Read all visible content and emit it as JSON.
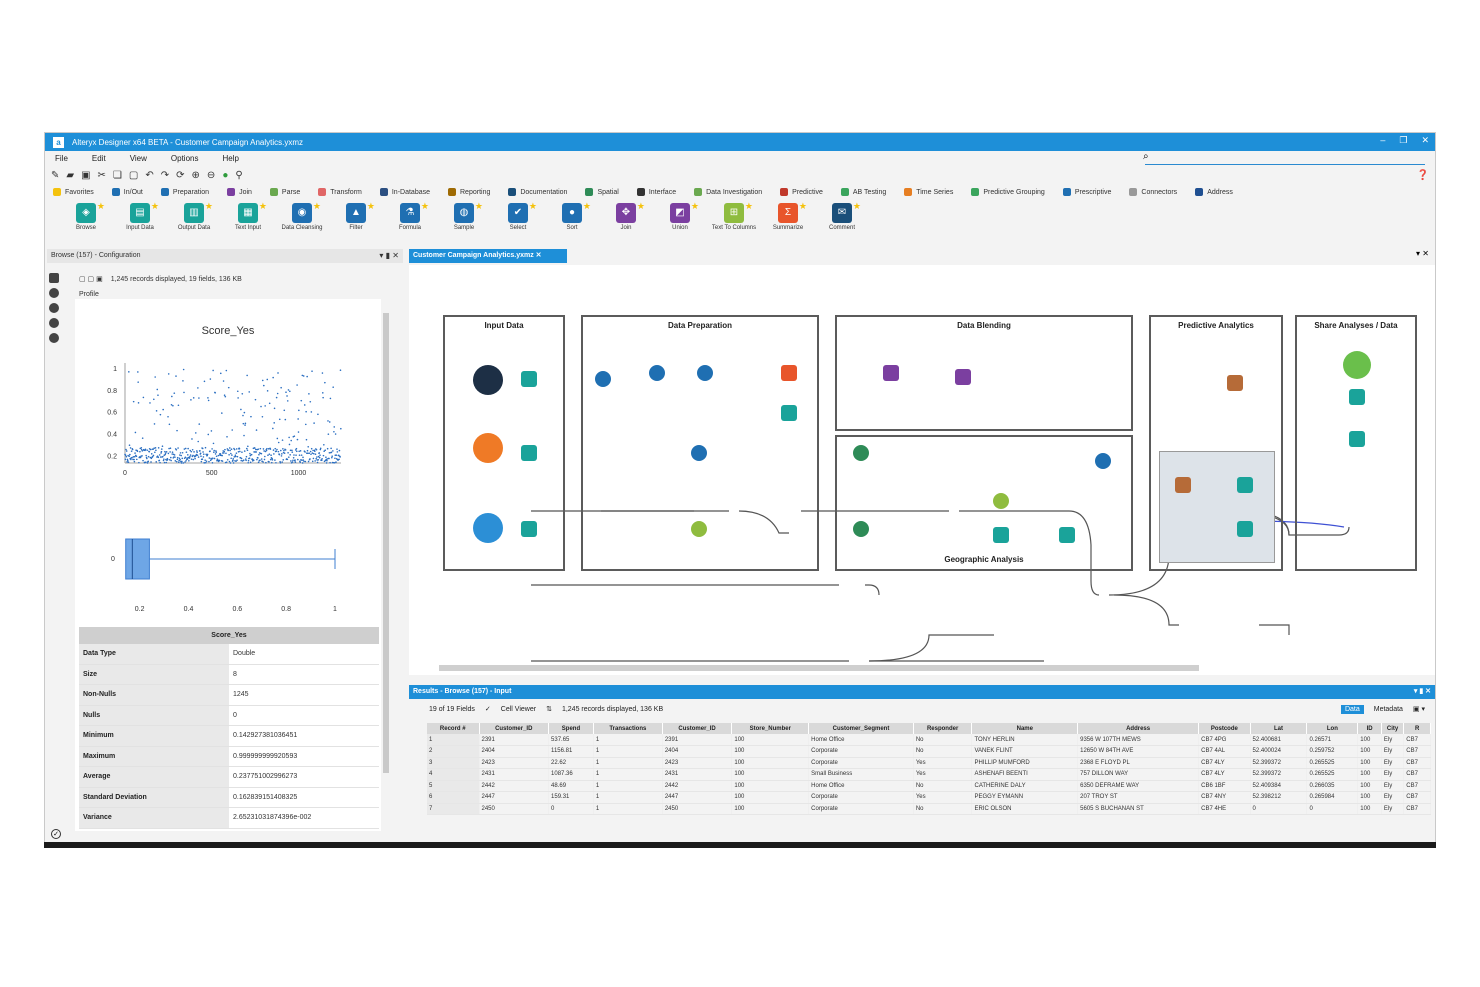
{
  "window": {
    "title": "Alteryx Designer x64 BETA - Customer Campaign Analytics.yxmz",
    "controls": [
      "–",
      "❐",
      "✕"
    ]
  },
  "menu": [
    "File",
    "Edit",
    "View",
    "Options",
    "Help"
  ],
  "categories": [
    {
      "label": "Favorites",
      "color": "#f4c20d"
    },
    {
      "label": "In/Out",
      "color": "#1f6fb2"
    },
    {
      "label": "Preparation",
      "color": "#1f6fb2"
    },
    {
      "label": "Join",
      "color": "#7b3fa0"
    },
    {
      "label": "Parse",
      "color": "#6aa84f"
    },
    {
      "label": "Transform",
      "color": "#e06666"
    },
    {
      "label": "In-Database",
      "color": "#2b4f81"
    },
    {
      "label": "Reporting",
      "color": "#9e6a03"
    },
    {
      "label": "Documentation",
      "color": "#1a4f7a"
    },
    {
      "label": "Spatial",
      "color": "#2e8b57"
    },
    {
      "label": "Interface",
      "color": "#333333"
    },
    {
      "label": "Data Investigation",
      "color": "#6aa84f"
    },
    {
      "label": "Predictive",
      "color": "#c0392b"
    },
    {
      "label": "AB Testing",
      "color": "#3aa55d"
    },
    {
      "label": "Time Series",
      "color": "#e67e22"
    },
    {
      "label": "Predictive Grouping",
      "color": "#3aa55d"
    },
    {
      "label": "Prescriptive",
      "color": "#1f6fb2"
    },
    {
      "label": "Connectors",
      "color": "#999999"
    },
    {
      "label": "Address",
      "color": "#1f4f91"
    }
  ],
  "palette": [
    {
      "label": "Browse",
      "color": "#1aa39a",
      "glyph": "◈"
    },
    {
      "label": "Input Data",
      "color": "#1aa39a",
      "glyph": "▤"
    },
    {
      "label": "Output Data",
      "color": "#1aa39a",
      "glyph": "▥"
    },
    {
      "label": "Text Input",
      "color": "#1aa39a",
      "glyph": "▦"
    },
    {
      "label": "Data Cleansing",
      "color": "#1f6fb2",
      "glyph": "◉"
    },
    {
      "label": "Filter",
      "color": "#1f6fb2",
      "glyph": "▲"
    },
    {
      "label": "Formula",
      "color": "#1f6fb2",
      "glyph": "⚗"
    },
    {
      "label": "Sample",
      "color": "#1f6fb2",
      "glyph": "◍"
    },
    {
      "label": "Select",
      "color": "#1f6fb2",
      "glyph": "✔"
    },
    {
      "label": "Sort",
      "color": "#1f6fb2",
      "glyph": "●"
    },
    {
      "label": "Join",
      "color": "#7b3fa0",
      "glyph": "✥"
    },
    {
      "label": "Union",
      "color": "#7b3fa0",
      "glyph": "◩"
    },
    {
      "label": "Text To Columns",
      "color": "#8fbc3f",
      "glyph": "⊞"
    },
    {
      "label": "Summarize",
      "color": "#e8552b",
      "glyph": "Σ"
    },
    {
      "label": "Comment",
      "color": "#1a4f7a",
      "glyph": "✉"
    }
  ],
  "left_panel": {
    "header": "Browse (157) - Configuration",
    "info": "1,245 records displayed, 19 fields, 136 KB",
    "tab": "Profile",
    "chart_title": "Score_Yes"
  },
  "chart_data": [
    {
      "type": "scatter",
      "title": "Score_Yes",
      "xlabel": "",
      "ylabel": "",
      "x_ticks": [
        "0",
        "500",
        "1000"
      ],
      "y_ticks": [
        "0.2",
        "0.4",
        "0.6",
        "0.8",
        "1"
      ],
      "xlim": [
        0,
        1245
      ],
      "ylim": [
        0.14,
        1.0
      ],
      "point_count": 1245,
      "distribution": "dense below 0.3, sparse up to 1.0"
    },
    {
      "type": "box",
      "x_ticks": [
        "0.2",
        "0.4",
        "0.6",
        "0.8",
        "1"
      ],
      "y_ticks": [
        "0"
      ],
      "min": 0.1429,
      "q1": 0.15,
      "median": 0.17,
      "q3": 0.24,
      "max": 1.0
    }
  ],
  "stats": {
    "title": "Score_Yes",
    "rows": [
      {
        "k": "Data Type",
        "v": "Double"
      },
      {
        "k": "Size",
        "v": "8"
      },
      {
        "k": "Non-Nulls",
        "v": "1245"
      },
      {
        "k": "Nulls",
        "v": "0"
      },
      {
        "k": "Minimum",
        "v": "0.142927381036451"
      },
      {
        "k": "Maximum",
        "v": "0.999999999920593"
      },
      {
        "k": "Average",
        "v": "0.237751002996273"
      },
      {
        "k": "Standard Deviation",
        "v": "0.162839151408325"
      },
      {
        "k": "Variance",
        "v": "2.65231031874396e-002"
      }
    ]
  },
  "canvas": {
    "tab": "Customer Campaign Analytics.yxmz",
    "boxes": [
      {
        "label": "Input Data"
      },
      {
        "label": "Data Preparation"
      },
      {
        "label": "Data Blending"
      },
      {
        "label": "Predictive Analytics"
      },
      {
        "label": "Share Analyses / Data"
      }
    ],
    "sub_label": "Geographic Analysis"
  },
  "results": {
    "header": "Results - Browse (157) - Input",
    "fields": "19 of 19 Fields",
    "viewer": "Cell Viewer",
    "info": "1,245 records displayed, 136 KB",
    "tab_data": "Data",
    "tab_meta": "Metadata",
    "columns": [
      "Record #",
      "Customer_ID",
      "Spend",
      "Transactions",
      "Customer_ID",
      "Store_Number",
      "Customer_Segment",
      "Responder",
      "Name",
      "Address",
      "Postcode",
      "Lat",
      "Lon",
      "ID",
      "City",
      "R"
    ],
    "rows": [
      [
        "1",
        "2391",
        "537.65",
        "1",
        "2391",
        "100",
        "Home Office",
        "No",
        "TONY HERLIN",
        "9356 W 107TH MEWS",
        "CB7 4PG",
        "52.400681",
        "0.26571",
        "100",
        "Ely",
        "CB7"
      ],
      [
        "2",
        "2404",
        "1156.81",
        "1",
        "2404",
        "100",
        "Corporate",
        "No",
        "VANEK FLINT",
        "12650 W 84TH AVE",
        "CB7 4AL",
        "52.400024",
        "0.259752",
        "100",
        "Ely",
        "CB7"
      ],
      [
        "3",
        "2423",
        "22.62",
        "1",
        "2423",
        "100",
        "Corporate",
        "Yes",
        "PHILLIP MUMFORD",
        "2368 E FLOYD PL",
        "CB7 4LY",
        "52.399372",
        "0.265525",
        "100",
        "Ely",
        "CB7"
      ],
      [
        "4",
        "2431",
        "1087.36",
        "1",
        "2431",
        "100",
        "Small Business",
        "Yes",
        "ASHENAFI BEENTI",
        "757 DILLON WAY",
        "CB7 4LY",
        "52.399372",
        "0.265525",
        "100",
        "Ely",
        "CB7"
      ],
      [
        "5",
        "2442",
        "48.69",
        "1",
        "2442",
        "100",
        "Home Office",
        "No",
        "CATHERINE DALY",
        "6350 DEFRAME WAY",
        "CB6 1BF",
        "52.409384",
        "0.266035",
        "100",
        "Ely",
        "CB7"
      ],
      [
        "6",
        "2447",
        "159.31",
        "1",
        "2447",
        "100",
        "Corporate",
        "Yes",
        "PEGGY EYMANN",
        "207 TROY ST",
        "CB7 4NY",
        "52.398212",
        "0.265984",
        "100",
        "Ely",
        "CB7"
      ],
      [
        "7",
        "2450",
        "0",
        "1",
        "2450",
        "100",
        "Corporate",
        "No",
        "ERIC OLSON",
        "5605 S BUCHANAN ST",
        "CB7 4HE",
        "0",
        "0",
        "100",
        "Ely",
        "CB7"
      ]
    ]
  }
}
